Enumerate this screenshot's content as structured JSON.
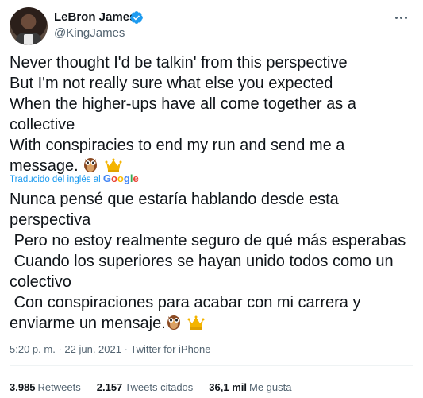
{
  "author": {
    "name": "LeBron James",
    "handle": "@KingJames",
    "verified_color": "#1d9bf0"
  },
  "tweet": {
    "original_text": "Never thought I'd be talkin' from this perspective\nBut I'm not really sure what else you expected\nWhen the higher-ups have all come together as a collective\nWith conspiracies to end my run and send me a message.",
    "translation_label": "Traducido del inglés al",
    "translation_provider": "Google",
    "translated_text": "Nunca pensé que estaría hablando desde esta perspectiva\n Pero no estoy realmente seguro de qué más esperabas\n Cuando los superiores se hayan unido todos como un colectivo\n Con conspiraciones para acabar con mi carrera y enviarme un mensaje."
  },
  "meta": {
    "time": "5:20 p. m.",
    "separator": "·",
    "date": "22 jun. 2021",
    "source": "Twitter for iPhone"
  },
  "stats": {
    "retweets_count": "3.985",
    "retweets_label": "Retweets",
    "quotes_count": "2.157",
    "quotes_label": "Tweets citados",
    "likes_count": "36,1 mil",
    "likes_label": "Me gusta"
  },
  "icons": [
    "verified-icon",
    "more-icon",
    "owl-emoji",
    "crown-emoji"
  ]
}
